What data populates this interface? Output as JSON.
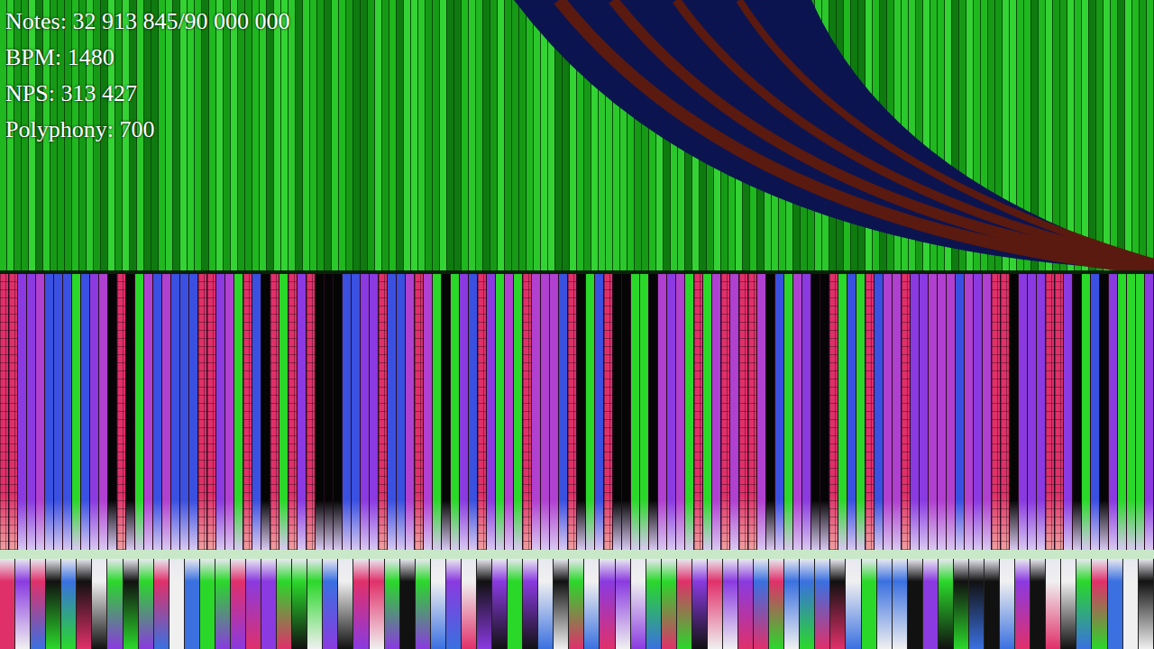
{
  "overlay": {
    "lines": [
      "Notes: 32 913 845/90 000 000",
      "BPM: 1480",
      "NPS: 313 427",
      "Polyphony: 700"
    ]
  }
}
